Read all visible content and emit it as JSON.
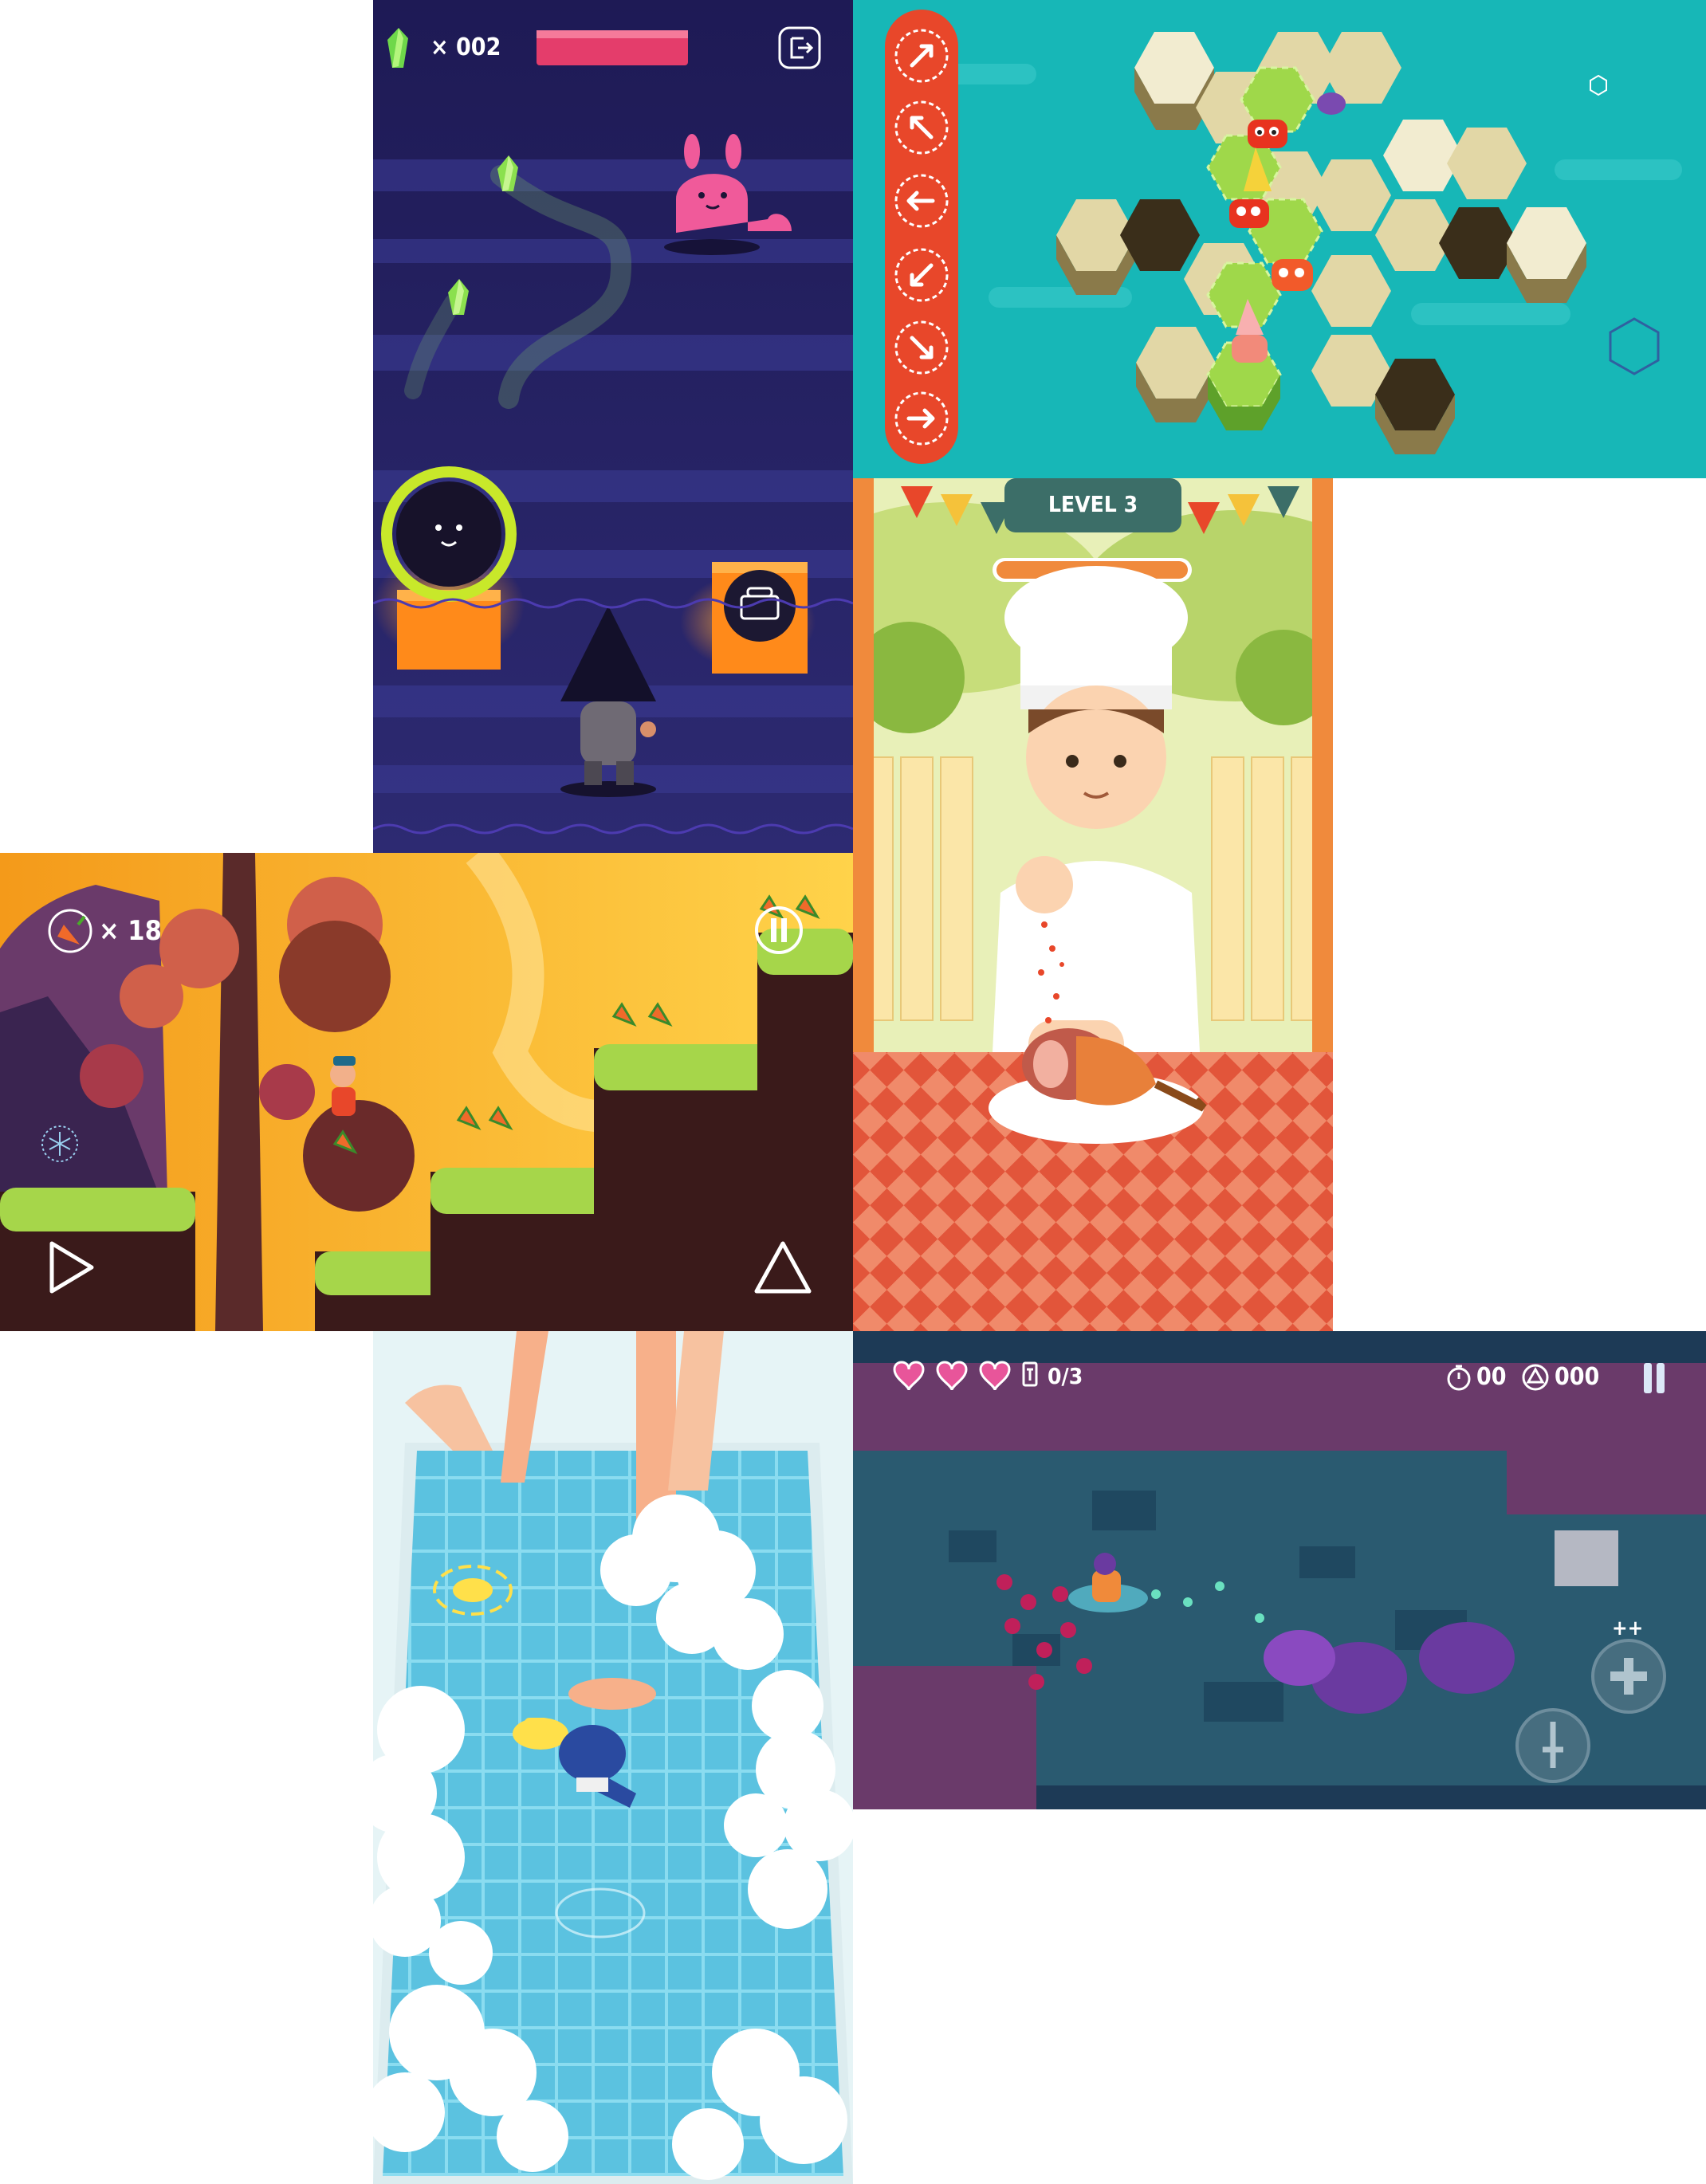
{
  "panels": {
    "night_garden": {
      "gem_count": "002",
      "gem_multiplier": "×",
      "icons": [
        "gem-icon",
        "exit-icon",
        "health-bar",
        "portal-hole",
        "lunchbox-icon"
      ],
      "colors": {
        "bg": "#2a2468",
        "gem": "#6fd84a",
        "health": "#e43d6b",
        "portal": "#c8e82a"
      }
    },
    "hex_puzzle": {
      "icons": [
        "arrow-up-right-icon",
        "arrow-up-left-icon",
        "arrow-left-icon",
        "arrow-down-left-icon",
        "arrow-down-right-icon",
        "arrow-right-icon"
      ],
      "colors": {
        "bg": "#17b7b7",
        "controls": "#e8472a",
        "path": "#9fd84a"
      }
    },
    "chef": {
      "level_label": "LEVEL 3",
      "progress": 1.0,
      "colors": {
        "banner": "#3c6e68",
        "progress": "#f08a3c",
        "tablecloth": "#e2553a"
      }
    },
    "jungle_runner": {
      "carrot_count": "18",
      "carrot_multiplier": "×",
      "icons": [
        "carrot-icon",
        "pause-icon",
        "play-icon",
        "jump-triangle-icon"
      ],
      "colors": {
        "sky": "#f7b52a",
        "grass": "#a6d64a"
      }
    },
    "bath": {
      "icons": [
        "target-ring-icon",
        "rubber-duck-icon",
        "hair-dryer-icon"
      ],
      "colors": {
        "water": "#6fcfe8",
        "foam": "#ffffff"
      }
    },
    "dungeon": {
      "hearts": 3,
      "keys": "0/3",
      "timer": "00",
      "score": "000",
      "plus_label": "++",
      "icons": [
        "heart-icon",
        "key-icon",
        "stopwatch-icon",
        "triangle-coin-icon",
        "pause-icon",
        "heal-button-icon",
        "sword-button-icon"
      ],
      "colors": {
        "bg": "#1d3a56",
        "heart": "#e8559a"
      }
    }
  }
}
